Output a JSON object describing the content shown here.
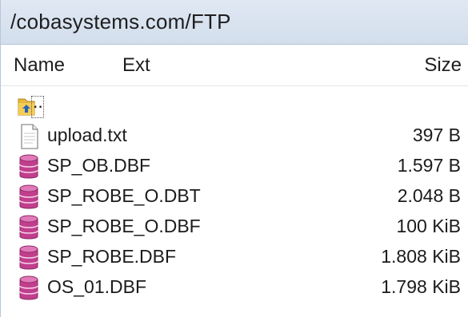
{
  "path": "/cobasystems.com/FTP",
  "columns": {
    "name": "Name",
    "ext": "Ext",
    "size": "Size"
  },
  "parent_dir": {
    "label": "..",
    "icon": "folder-up-icon"
  },
  "files": [
    {
      "name": "upload.txt",
      "size": "397 B",
      "icon": "text-file-icon"
    },
    {
      "name": "SP_OB.DBF",
      "size": "1.597 B",
      "icon": "database-file-icon"
    },
    {
      "name": "SP_ROBE_O.DBT",
      "size": "2.048 B",
      "icon": "database-file-icon"
    },
    {
      "name": "SP_ROBE_O.DBF",
      "size": "100 KiB",
      "icon": "database-file-icon"
    },
    {
      "name": "SP_ROBE.DBF",
      "size": "1.808 KiB",
      "icon": "database-file-icon"
    },
    {
      "name": "OS_01.DBF",
      "size": "1.798 KiB",
      "icon": "database-file-icon"
    }
  ],
  "colors": {
    "path_bar": "#d8e2ef",
    "db_icon": "#c13f8d"
  }
}
